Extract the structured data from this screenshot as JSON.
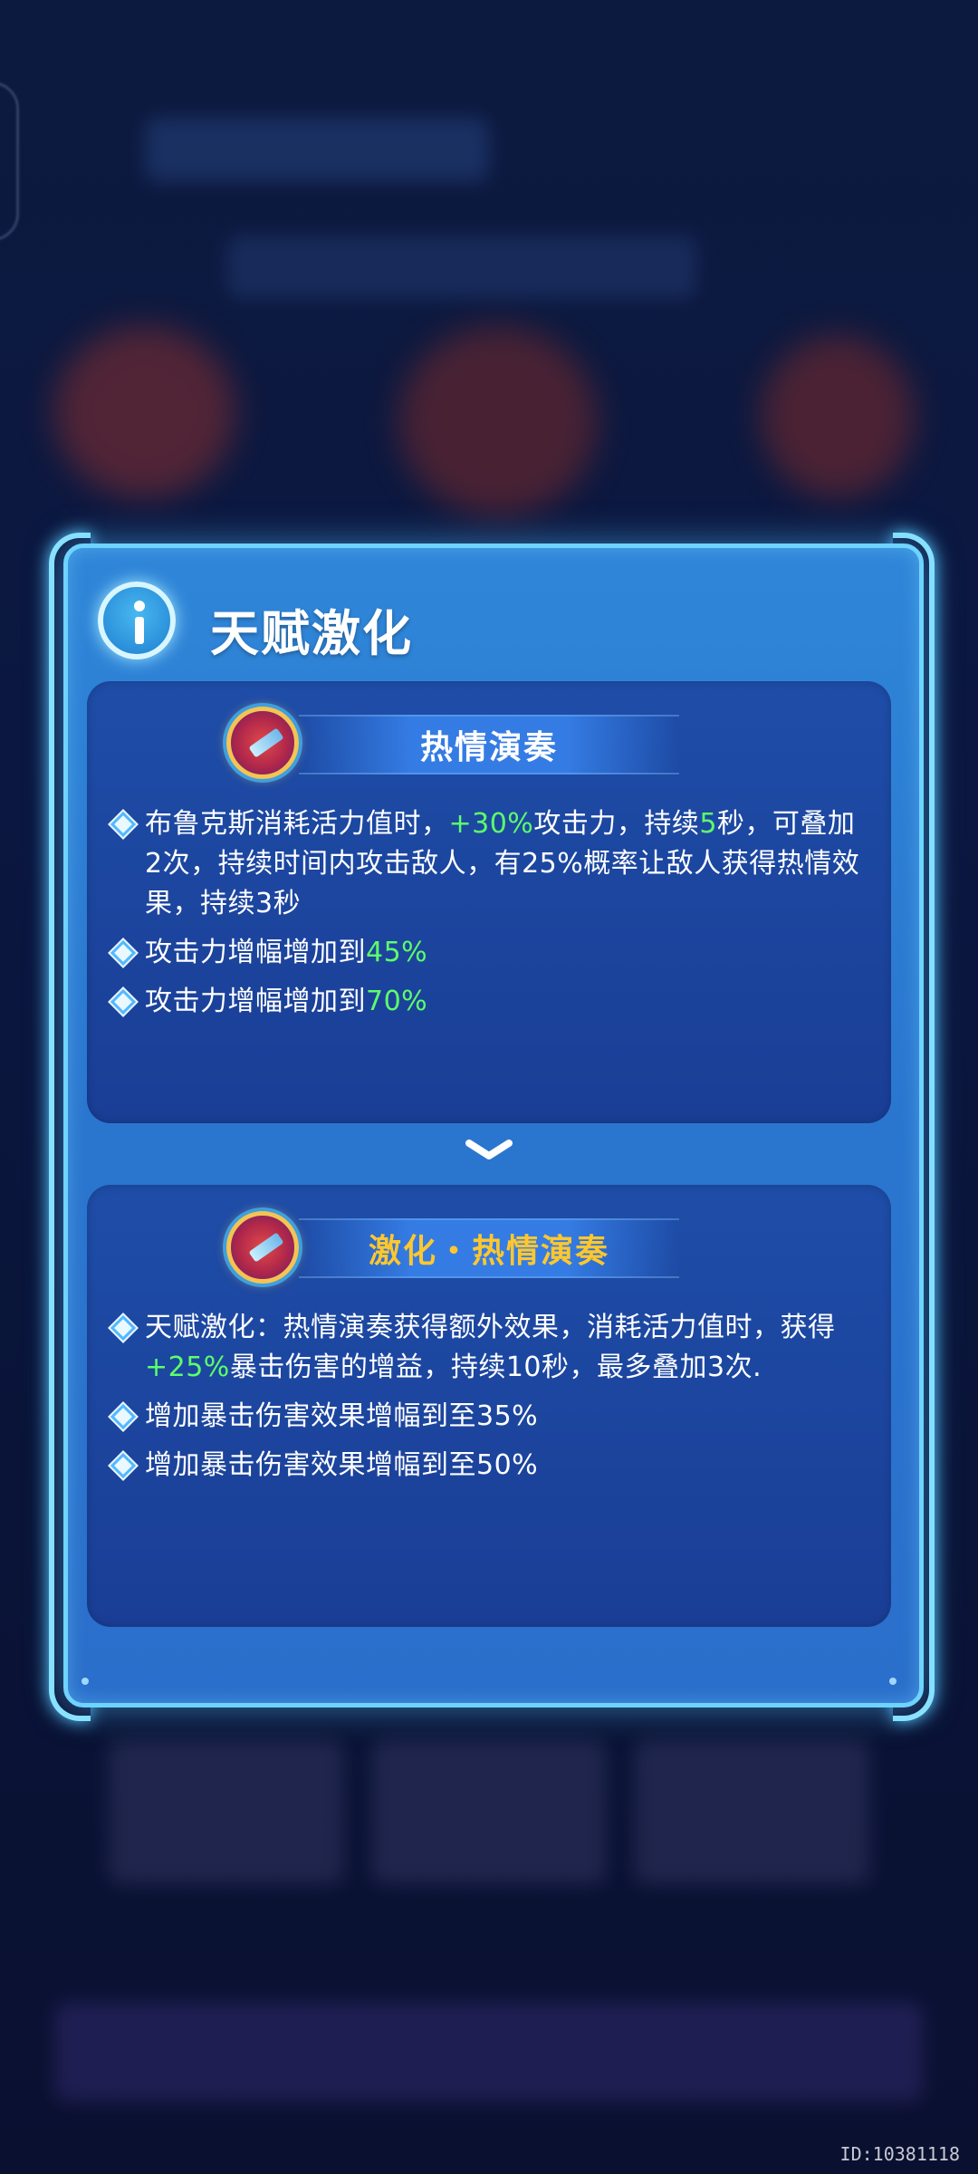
{
  "dialog": {
    "title": "天赋激化",
    "info_icon": "info-icon"
  },
  "skill1": {
    "name": "热情演奏",
    "icon": "sword-medal-icon",
    "lines": [
      {
        "parts": [
          [
            "布鲁克斯消耗活力值时，",
            ""
          ],
          [
            "+30%",
            "hl"
          ],
          [
            "攻击力，持续",
            ""
          ],
          [
            "5",
            "hl"
          ],
          [
            "秒，可叠加2次，持续时间内攻击敌人，有25%概率让敌人获得热情效果，持续3秒",
            ""
          ]
        ]
      },
      {
        "parts": [
          [
            "攻击力增幅增加到",
            ""
          ],
          [
            "45%",
            "hl"
          ]
        ]
      },
      {
        "parts": [
          [
            "攻击力增幅增加到",
            ""
          ],
          [
            "70%",
            "hl"
          ]
        ]
      }
    ]
  },
  "skill2": {
    "name": "激化・热情演奏",
    "icon": "sword-medal-icon",
    "lines": [
      {
        "parts": [
          [
            "天赋激化：热情演奏获得额外效果，消耗活力值时，获得",
            ""
          ],
          [
            "+25%",
            "hl"
          ],
          [
            "暴击伤害的增益，持续10秒，最多叠加3次.",
            ""
          ]
        ]
      },
      {
        "parts": [
          [
            "增加暴击伤害效果增幅到至35%",
            ""
          ]
        ]
      },
      {
        "parts": [
          [
            "增加暴击伤害效果增幅到至50%",
            ""
          ]
        ]
      }
    ]
  },
  "id_text": "ID:10381118",
  "colors": {
    "highlight": "#5dff6a",
    "title_gold": "#ffc72e",
    "frame": "#6fd3ff"
  }
}
